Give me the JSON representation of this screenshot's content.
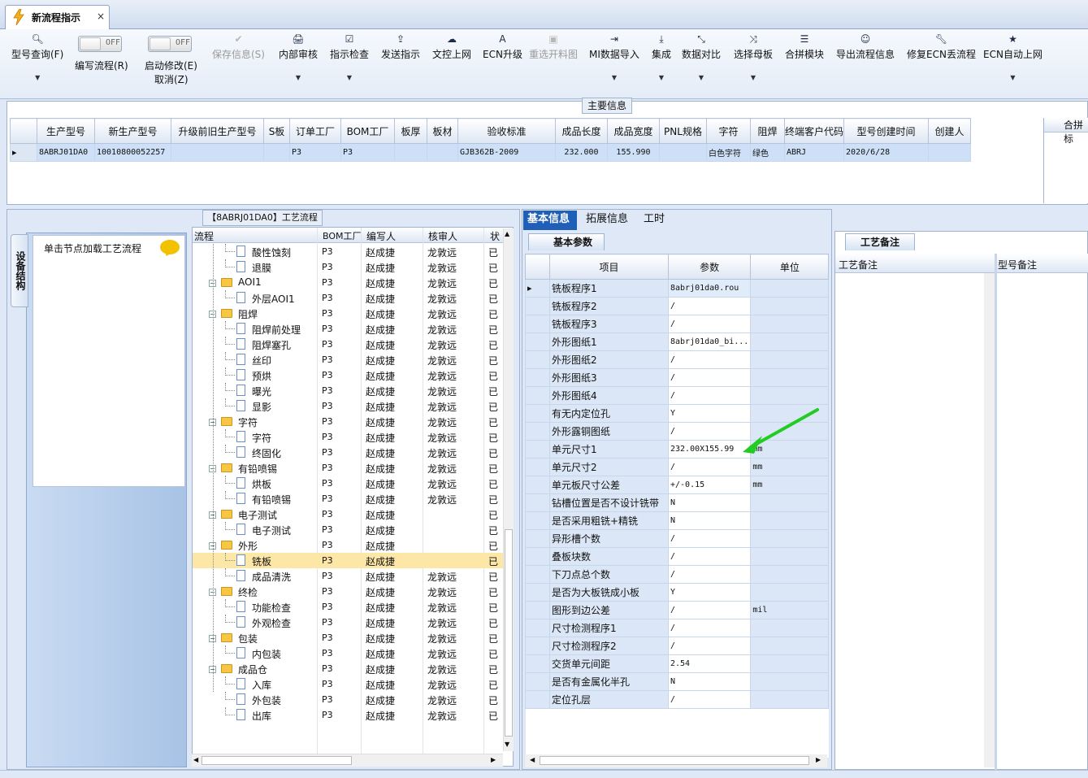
{
  "window": {
    "tab_title": "新流程指示",
    "close_glyph": "×"
  },
  "toolbar": {
    "items": [
      {
        "icon": "search-icon",
        "glyph": "🔍︎",
        "label": "型号查询(F)",
        "dropdown": true,
        "enabled": true
      },
      {
        "toggle_state": "OFF",
        "label": "编写流程(R)"
      },
      {
        "toggle_state": "OFF",
        "label": "启动修改(E)",
        "label2": "取消(Z)"
      },
      {
        "icon": "check-icon",
        "glyph": "✔",
        "label": "保存信息(S)",
        "enabled": false
      },
      {
        "icon": "printer-icon",
        "glyph": "🖨︎",
        "label": "内部审核",
        "dropdown": true,
        "enabled": true
      },
      {
        "icon": "checkbox-icon",
        "glyph": "☑",
        "label": "指示检查",
        "dropdown": true,
        "enabled": true
      },
      {
        "icon": "upload-icon",
        "glyph": "⇪",
        "label": "发送指示",
        "enabled": true
      },
      {
        "icon": "cloud-upload-icon",
        "glyph": "☁",
        "label": "文控上网",
        "enabled": true
      },
      {
        "icon": "font-icon",
        "glyph": "A",
        "label": "ECN升级",
        "enabled": true
      },
      {
        "icon": "image-icon",
        "glyph": "▣",
        "label": "重选开料图",
        "enabled": false
      },
      {
        "icon": "import-icon",
        "glyph": "⇥",
        "label": "MI数据导入",
        "dropdown": true,
        "enabled": true
      },
      {
        "icon": "download-icon",
        "glyph": "⤓",
        "label": "集成",
        "dropdown": true,
        "enabled": true
      },
      {
        "icon": "compare-icon",
        "glyph": "⤡",
        "label": "数据对比",
        "dropdown": true,
        "enabled": true
      },
      {
        "icon": "shuffle-icon",
        "glyph": "⤨",
        "label": "选择母板",
        "dropdown": true,
        "enabled": true
      },
      {
        "icon": "list-icon",
        "glyph": "☰",
        "label": "合拼模块",
        "enabled": true
      },
      {
        "icon": "smile-icon",
        "glyph": "☺",
        "label": "导出流程信息",
        "enabled": true
      },
      {
        "icon": "wrench-icon",
        "glyph": "🔧︎",
        "label": "修复ECN丢流程",
        "enabled": true
      },
      {
        "icon": "star-icon",
        "glyph": "★",
        "label": "ECN自动上网",
        "dropdown": true,
        "enabled": true
      }
    ]
  },
  "main_info": {
    "title": "主要信息",
    "columns": [
      "生产型号",
      "新生产型号",
      "升级前旧生产型号",
      "S板",
      "订单工厂",
      "BOM工厂",
      "板厚",
      "板材",
      "验收标准",
      "成品长度",
      "成品宽度",
      "PNL规格",
      "字符",
      "阻焊",
      "终端客户代码",
      "型号创建时间",
      "创建人"
    ],
    "rows": [
      [
        "8ABRJ01DA0",
        "10010800052257",
        "",
        "",
        "P3",
        "P3",
        "",
        "",
        "GJB362B-2009",
        "232.000",
        "155.990",
        "",
        "白色字符",
        "绿色",
        "ABRJ",
        "2020/6/28",
        ""
      ]
    ],
    "merge_header": "合拼标"
  },
  "left": {
    "vertical_tab": "设备结构",
    "node_hint": "单击节点加载工艺流程",
    "process_title": "【8ABRJ01DA0】工艺流程",
    "tree_columns": [
      "流程",
      "BOM工厂",
      "编写人",
      "核审人",
      "状"
    ],
    "tree_rows": [
      {
        "name": "酸性蚀刻",
        "level": 1,
        "folder": false,
        "bom": "P3",
        "writer": "赵成捷",
        "reviewer": "龙敦远",
        "status": "已"
      },
      {
        "name": "退膜",
        "level": 1,
        "folder": false,
        "bom": "P3",
        "writer": "赵成捷",
        "reviewer": "龙敦远",
        "status": "已"
      },
      {
        "name": "AOI1",
        "level": 0,
        "folder": true,
        "bom": "P3",
        "writer": "赵成捷",
        "reviewer": "龙敦远",
        "status": "已"
      },
      {
        "name": "外层AOI1",
        "level": 1,
        "folder": false,
        "bom": "P3",
        "writer": "赵成捷",
        "reviewer": "龙敦远",
        "status": "已"
      },
      {
        "name": "阻焊",
        "level": 0,
        "folder": true,
        "bom": "P3",
        "writer": "赵成捷",
        "reviewer": "龙敦远",
        "status": "已"
      },
      {
        "name": "阻焊前处理",
        "level": 1,
        "folder": false,
        "bom": "P3",
        "writer": "赵成捷",
        "reviewer": "龙敦远",
        "status": "已"
      },
      {
        "name": "阻焊塞孔",
        "level": 1,
        "folder": false,
        "bom": "P3",
        "writer": "赵成捷",
        "reviewer": "龙敦远",
        "status": "已"
      },
      {
        "name": "丝印",
        "level": 1,
        "folder": false,
        "bom": "P3",
        "writer": "赵成捷",
        "reviewer": "龙敦远",
        "status": "已"
      },
      {
        "name": "预烘",
        "level": 1,
        "folder": false,
        "bom": "P3",
        "writer": "赵成捷",
        "reviewer": "龙敦远",
        "status": "已"
      },
      {
        "name": "曝光",
        "level": 1,
        "folder": false,
        "bom": "P3",
        "writer": "赵成捷",
        "reviewer": "龙敦远",
        "status": "已"
      },
      {
        "name": "显影",
        "level": 1,
        "folder": false,
        "bom": "P3",
        "writer": "赵成捷",
        "reviewer": "龙敦远",
        "status": "已"
      },
      {
        "name": "字符",
        "level": 0,
        "folder": true,
        "bom": "P3",
        "writer": "赵成捷",
        "reviewer": "龙敦远",
        "status": "已"
      },
      {
        "name": "字符",
        "level": 1,
        "folder": false,
        "bom": "P3",
        "writer": "赵成捷",
        "reviewer": "龙敦远",
        "status": "已"
      },
      {
        "name": "终固化",
        "level": 1,
        "folder": false,
        "bom": "P3",
        "writer": "赵成捷",
        "reviewer": "龙敦远",
        "status": "已"
      },
      {
        "name": "有铅喷锡",
        "level": 0,
        "folder": true,
        "bom": "P3",
        "writer": "赵成捷",
        "reviewer": "龙敦远",
        "status": "已"
      },
      {
        "name": "烘板",
        "level": 1,
        "folder": false,
        "bom": "P3",
        "writer": "赵成捷",
        "reviewer": "龙敦远",
        "status": "已"
      },
      {
        "name": "有铅喷锡",
        "level": 1,
        "folder": false,
        "bom": "P3",
        "writer": "赵成捷",
        "reviewer": "龙敦远",
        "status": "已"
      },
      {
        "name": "电子测试",
        "level": 0,
        "folder": true,
        "bom": "P3",
        "writer": "赵成捷",
        "reviewer": "",
        "status": "已"
      },
      {
        "name": "电子测试",
        "level": 1,
        "folder": false,
        "bom": "P3",
        "writer": "赵成捷",
        "reviewer": "",
        "status": "已"
      },
      {
        "name": "外形",
        "level": 0,
        "folder": true,
        "bom": "P3",
        "writer": "赵成捷",
        "reviewer": "",
        "status": "已"
      },
      {
        "name": "铣板",
        "level": 1,
        "folder": false,
        "bom": "P3",
        "writer": "赵成捷",
        "reviewer": "",
        "status": "已",
        "selected": true
      },
      {
        "name": "成品清洗",
        "level": 1,
        "folder": false,
        "bom": "P3",
        "writer": "赵成捷",
        "reviewer": "龙敦远",
        "status": "已"
      },
      {
        "name": "终检",
        "level": 0,
        "folder": true,
        "bom": "P3",
        "writer": "赵成捷",
        "reviewer": "龙敦远",
        "status": "已"
      },
      {
        "name": "功能检查",
        "level": 1,
        "folder": false,
        "bom": "P3",
        "writer": "赵成捷",
        "reviewer": "龙敦远",
        "status": "已"
      },
      {
        "name": "外观检查",
        "level": 1,
        "folder": false,
        "bom": "P3",
        "writer": "赵成捷",
        "reviewer": "龙敦远",
        "status": "已"
      },
      {
        "name": "包装",
        "level": 0,
        "folder": true,
        "bom": "P3",
        "writer": "赵成捷",
        "reviewer": "龙敦远",
        "status": "已"
      },
      {
        "name": "内包装",
        "level": 1,
        "folder": false,
        "bom": "P3",
        "writer": "赵成捷",
        "reviewer": "龙敦远",
        "status": "已"
      },
      {
        "name": "成品仓",
        "level": 0,
        "folder": true,
        "bom": "P3",
        "writer": "赵成捷",
        "reviewer": "龙敦远",
        "status": "已"
      },
      {
        "name": "入库",
        "level": 1,
        "folder": false,
        "bom": "P3",
        "writer": "赵成捷",
        "reviewer": "龙敦远",
        "status": "已"
      },
      {
        "name": "外包装",
        "level": 1,
        "folder": false,
        "bom": "P3",
        "writer": "赵成捷",
        "reviewer": "龙敦远",
        "status": "已"
      },
      {
        "name": "出库",
        "level": 1,
        "folder": false,
        "bom": "P3",
        "writer": "赵成捷",
        "reviewer": "龙敦远",
        "status": "已"
      }
    ]
  },
  "right": {
    "tabs": [
      "基本信息",
      "拓展信息",
      "工时"
    ],
    "subtab": "基本参数",
    "columns": [
      "项目",
      "参数",
      "单位"
    ],
    "params": [
      {
        "item": "铣板程序1",
        "value": "8abrj01da0.rou",
        "unit": "",
        "selected": true
      },
      {
        "item": "铣板程序2",
        "value": "/",
        "unit": ""
      },
      {
        "item": "铣板程序3",
        "value": "/",
        "unit": ""
      },
      {
        "item": "外形图纸1",
        "value": "8abrj01da0_bi...",
        "unit": ""
      },
      {
        "item": "外形图纸2",
        "value": "/",
        "unit": ""
      },
      {
        "item": "外形图纸3",
        "value": "/",
        "unit": ""
      },
      {
        "item": "外形图纸4",
        "value": "/",
        "unit": ""
      },
      {
        "item": "有无内定位孔",
        "value": "Y",
        "unit": ""
      },
      {
        "item": "外形露铜图纸",
        "value": "/",
        "unit": ""
      },
      {
        "item": "单元尺寸1",
        "value": "232.00X155.99",
        "unit": "mm"
      },
      {
        "item": "单元尺寸2",
        "value": "/",
        "unit": "mm"
      },
      {
        "item": "单元板尺寸公差",
        "value": "+/-0.15",
        "unit": "mm"
      },
      {
        "item": "钻槽位置是否不设计铣带",
        "value": "N",
        "unit": ""
      },
      {
        "item": "是否采用粗铣+精铣",
        "value": "N",
        "unit": ""
      },
      {
        "item": "异形槽个数",
        "value": "/",
        "unit": ""
      },
      {
        "item": "叠板块数",
        "value": "/",
        "unit": ""
      },
      {
        "item": "下刀点总个数",
        "value": "/",
        "unit": ""
      },
      {
        "item": "是否为大板铣成小板",
        "value": "Y",
        "unit": ""
      },
      {
        "item": "图形到边公差",
        "value": "/",
        "unit": "mil"
      },
      {
        "item": "尺寸检测程序1",
        "value": "/",
        "unit": ""
      },
      {
        "item": "尺寸检测程序2",
        "value": "/",
        "unit": ""
      },
      {
        "item": "交货单元间距",
        "value": "2.54",
        "unit": ""
      },
      {
        "item": "是否有金属化半孔",
        "value": "N",
        "unit": ""
      },
      {
        "item": "定位孔层",
        "value": "/",
        "unit": ""
      }
    ]
  },
  "notes": {
    "tab": "工艺备注",
    "col1": "工艺备注",
    "col2": "型号备注"
  },
  "colors": {
    "accent": "#1f5fb8",
    "selected_row": "#fde7a6",
    "arrow": "#22cc22"
  }
}
